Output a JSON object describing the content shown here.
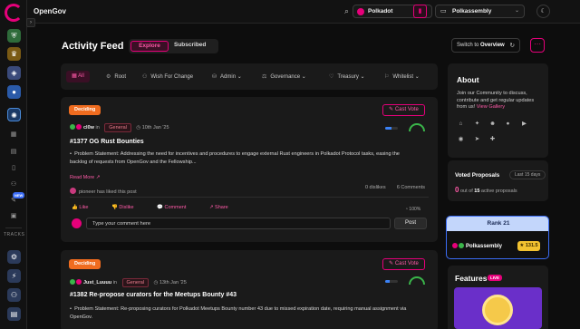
{
  "app": {
    "title": "OpenGov"
  },
  "topbar": {
    "network": "Polkadot",
    "account": "Polkassembly"
  },
  "rail": {
    "new_badge": "NEW",
    "tracks_label": "TRACKS"
  },
  "header": {
    "title": "Activity Feed",
    "tabs": [
      "Explore",
      "Subscribed"
    ],
    "switch_prefix": "Switch to ",
    "switch_target": "Overview"
  },
  "filters": [
    "All",
    "Root",
    "Wish For Change",
    "Admin",
    "Governance",
    "Treasury",
    "Whitelist"
  ],
  "posts": [
    {
      "status": "Deciding",
      "author": "cl0w",
      "in_label": "in",
      "tag": "General",
      "date": "10th Jan '25",
      "cast_vote": "Cast Vote",
      "title": "#1377 OG Rust Bounties",
      "description": "Problem Statement: Addressing the need for incentives and procedures to engage external Rust engineers in Polkadot Protocol tasks, easing the backlog of requests from OpenGov and the Fellowship...",
      "read_more": "Read More",
      "liked_by": "pioneer has liked this post",
      "dislikes": "0 dislikes",
      "comments": "6 Comments",
      "like": "Like",
      "dislike": "Dislike",
      "comment": "Comment",
      "share": "Share",
      "percent": "100%",
      "comment_placeholder": "Type your comment here",
      "post_button": "Post",
      "progress": 0.5
    },
    {
      "status": "Deciding",
      "author": "Just_Luuuu",
      "in_label": "in",
      "tag": "General",
      "date": "13th Jan '25",
      "cast_vote": "Cast Vote",
      "title": "#1382 Re-propose curators for the Meetups Bounty #43",
      "description": "Problem Statement: Re-proposing curators for Polkadot Meetups Bounty number 43 due to missed expiration date, requiring manual assignment via OpenGov.",
      "progress": 0.35
    }
  ],
  "about": {
    "title": "About",
    "text": "Join our Community to discuss, contribute and get regular updates from us! ",
    "link": "View Gallery"
  },
  "voted": {
    "title": "Voted Proposals",
    "period": "Last 15 days",
    "count": "0",
    "out_of": " out of ",
    "total": "15",
    "suffix": " active proposals"
  },
  "rank": {
    "title": "Rank 21",
    "user": "Polkassembly",
    "score": "131.5"
  },
  "features": {
    "title": "Features",
    "live": "LIVE"
  },
  "colors": {
    "accent": "#e6007a",
    "deciding": "#f06c1f",
    "background": "#0d0d0d",
    "card": "#1a1a1a"
  }
}
